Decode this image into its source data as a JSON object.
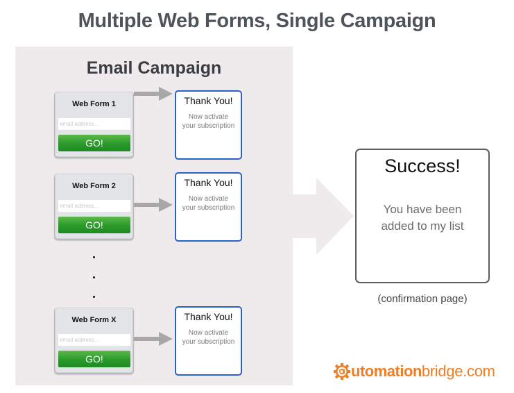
{
  "title": "Multiple Web Forms, Single Campaign",
  "panel": {
    "title": "Email Campaign",
    "forms": [
      {
        "title": "Web Form 1",
        "placeholder": "email address...",
        "button": "GO!"
      },
      {
        "title": "Web Form 2",
        "placeholder": "email address...",
        "button": "GO!"
      },
      {
        "title": "Web Form X",
        "placeholder": "email address...",
        "button": "GO!"
      }
    ],
    "thank_you_pages": [
      {
        "title": "Thank You!",
        "line1": "Now activate",
        "line2": "your subscription"
      },
      {
        "title": "Thank You!",
        "line1": "Now activate",
        "line2": "your subscription"
      },
      {
        "title": "Thank You!",
        "line1": "Now activate",
        "line2": "your subscription"
      }
    ],
    "ellipsis": "⋮"
  },
  "success": {
    "title": "Success!",
    "line1": "You have been",
    "line2": "added to my list",
    "caption": "(confirmation page)"
  },
  "logo": {
    "bold_part": "utomation",
    "light_part": "bridge",
    "suffix": ".com",
    "color": "#ef7d22"
  },
  "colors": {
    "panel_bg": "#efeaeb",
    "thank_you_border": "#2a63c7",
    "go_button": "#2a9a2a",
    "arrow": "#a8a8a8",
    "big_arrow": "#efeaeb",
    "title_text": "#4f545b"
  }
}
